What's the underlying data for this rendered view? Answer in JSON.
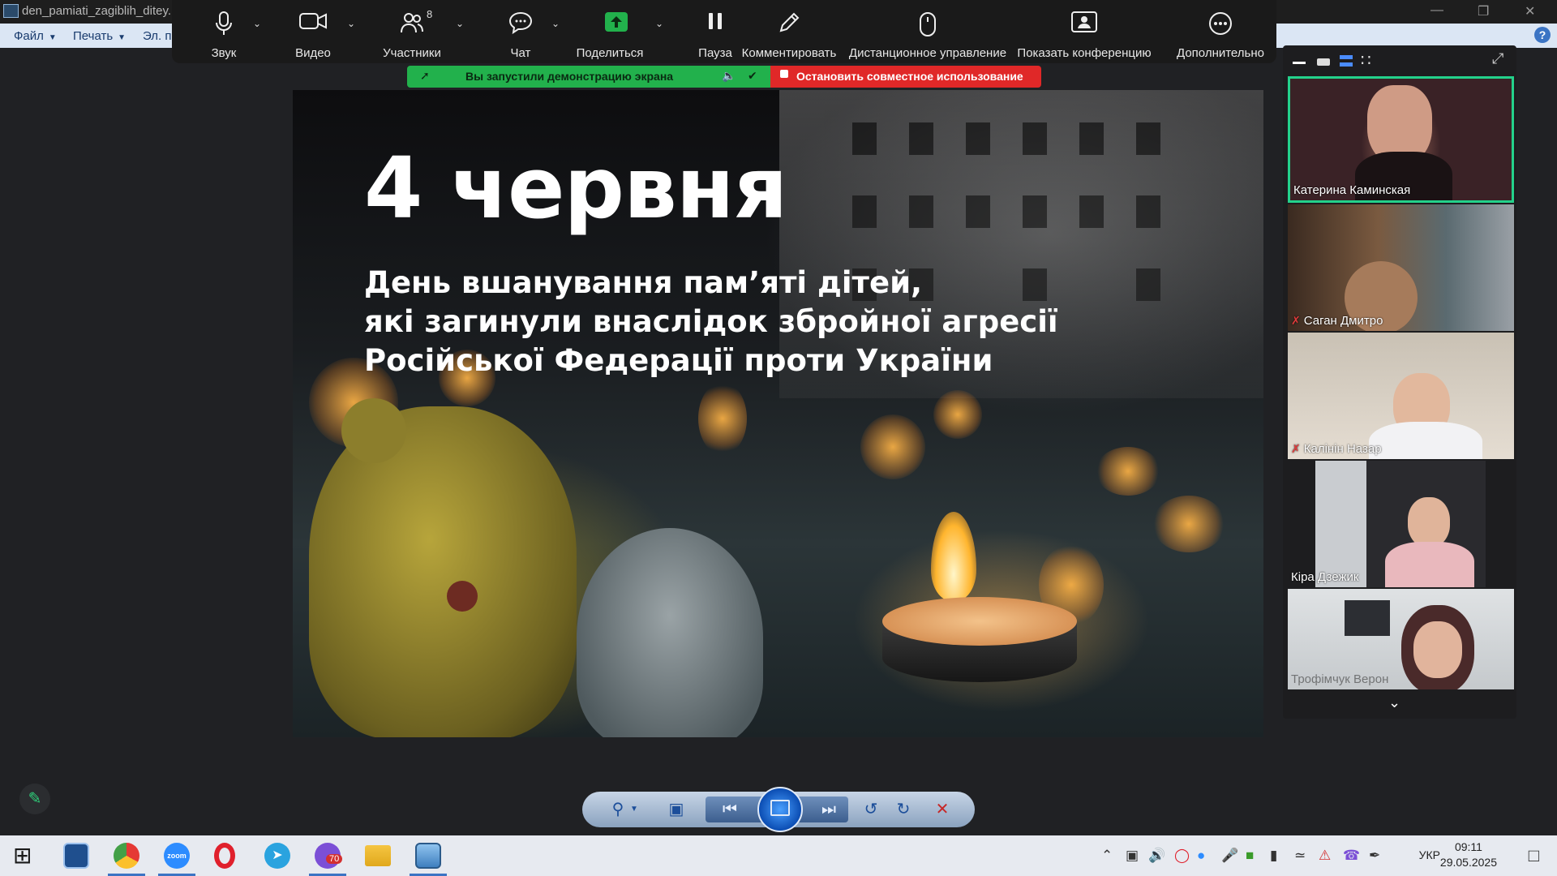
{
  "window": {
    "title": "den_pamiati_zagiblih_ditey.",
    "menu": [
      "Файл",
      "Печать",
      "Эл. п"
    ]
  },
  "zoom_toolbar": {
    "items": [
      {
        "label": "Звук",
        "icon": "microphone-icon"
      },
      {
        "label": "Видео",
        "icon": "video-camera-icon"
      },
      {
        "label": "Участники",
        "icon": "participants-icon",
        "count": "8"
      },
      {
        "label": "Чат",
        "icon": "chat-icon"
      },
      {
        "label": "Поделиться",
        "icon": "share-screen-icon"
      },
      {
        "label": "Пауза",
        "icon": "pause-icon"
      },
      {
        "label": "Комментировать",
        "icon": "annotate-pencil-icon"
      },
      {
        "label": "Дистанционное управление",
        "icon": "remote-control-mouse-icon"
      },
      {
        "label": "Показать конференцию",
        "icon": "show-meeting-icon"
      },
      {
        "label": "Дополнительно",
        "icon": "more-icon"
      }
    ]
  },
  "share_banner": {
    "status_text": "Вы запустили демонстрацию экрана",
    "stop_text": "Остановить совместное использование",
    "green": "#22b14c",
    "red": "#e02828"
  },
  "slide": {
    "heading": "4 червня",
    "lines": [
      "День вшанування пам’яті дітей,",
      "які загинули внаслідок збройної агресії",
      "Російської Федерації проти України"
    ]
  },
  "participants": [
    {
      "name": "Катерина Каминская",
      "muted": false,
      "active": true
    },
    {
      "name": "Саган Дмитро",
      "muted": true,
      "active": false
    },
    {
      "name": "Калінін Назар",
      "muted": true,
      "active": false
    },
    {
      "name": "Кіра Дзежик",
      "muted": false,
      "active": false
    },
    {
      "name": "Трофімчук Верон",
      "muted": false,
      "active": false
    }
  ],
  "taskbar": {
    "language": "УКР",
    "time": "09:11",
    "date": "29.05.2025",
    "badge": "70"
  }
}
